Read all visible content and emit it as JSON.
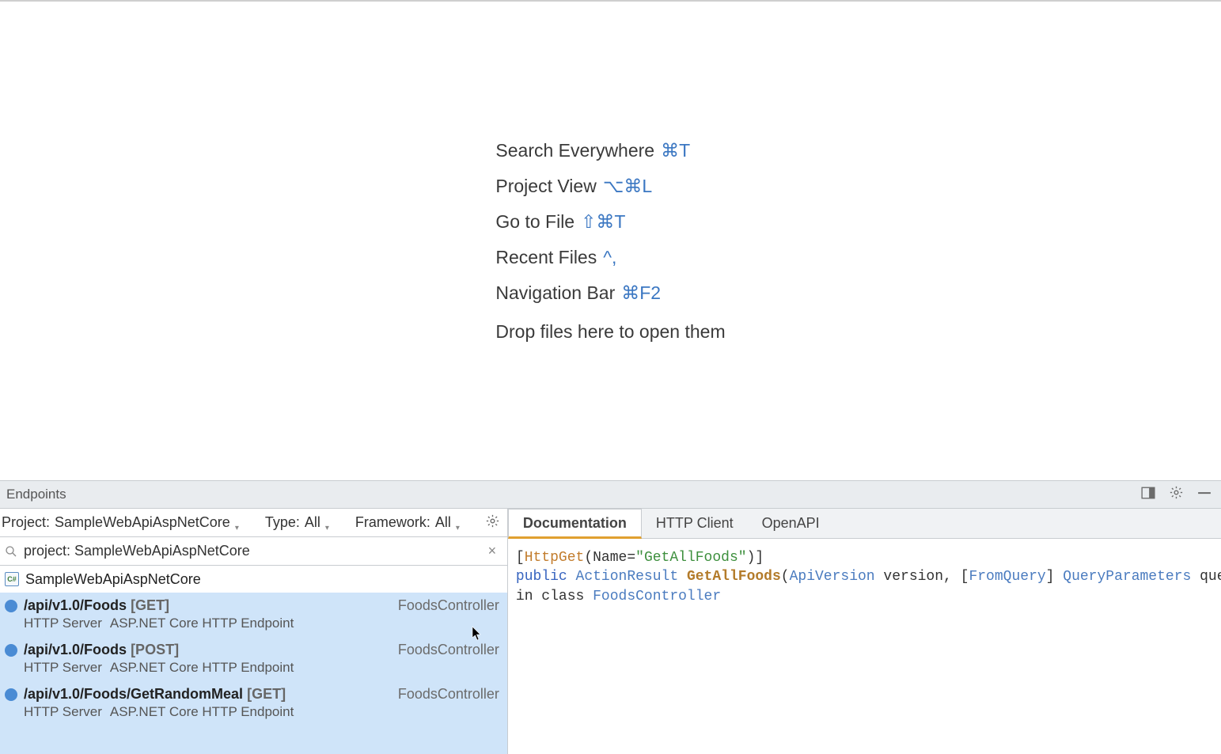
{
  "hints": {
    "search_everywhere": "Search Everywhere",
    "search_everywhere_sc": "⌘T",
    "project_view": "Project View",
    "project_view_sc": "⌥⌘L",
    "go_to_file": "Go to File",
    "go_to_file_sc": "⇧⌘T",
    "recent_files": "Recent Files",
    "recent_files_sc": "^,",
    "nav_bar": "Navigation Bar",
    "nav_bar_sc": "⌘F2",
    "drop_files": "Drop files here to open them"
  },
  "toolwindow": {
    "title": "Endpoints"
  },
  "filters": {
    "project_label": "Project:",
    "project_value": "SampleWebApiAspNetCore",
    "type_label": "Type:",
    "type_value": "All",
    "framework_label": "Framework:",
    "framework_value": "All"
  },
  "search": {
    "value": "project: SampleWebApiAspNetCore "
  },
  "project_group": {
    "name": "SampleWebApiAspNetCore"
  },
  "endpoints": [
    {
      "path": "/api/v1.0/Foods",
      "method": "[GET]",
      "server": "HTTP Server",
      "desc": "ASP.NET Core HTTP Endpoint",
      "controller": "FoodsController"
    },
    {
      "path": "/api/v1.0/Foods",
      "method": "[POST]",
      "server": "HTTP Server",
      "desc": "ASP.NET Core HTTP Endpoint",
      "controller": "FoodsController"
    },
    {
      "path": "/api/v1.0/Foods/GetRandomMeal",
      "method": "[GET]",
      "server": "HTTP Server",
      "desc": "ASP.NET Core HTTP Endpoint",
      "controller": "FoodsController"
    }
  ],
  "tabs": {
    "documentation": "Documentation",
    "http_client": "HTTP Client",
    "openapi": "OpenAPI"
  },
  "doc": {
    "l1_a": "[",
    "l1_b": "HttpGet",
    "l1_c": "(Name=",
    "l1_d": "\"GetAllFoods\"",
    "l1_e": ")]",
    "l2_a": "public",
    "l2_b": "ActionResult",
    "l2_c": "GetAllFoods",
    "l2_d": "(",
    "l2_e": "ApiVersion",
    "l2_f": " version, [",
    "l2_g": "FromQuery",
    "l2_h": "] ",
    "l2_i": "QueryParameters",
    "l2_j": " queryParameter",
    "l3_a": "in class ",
    "l3_b": "FoodsController"
  }
}
